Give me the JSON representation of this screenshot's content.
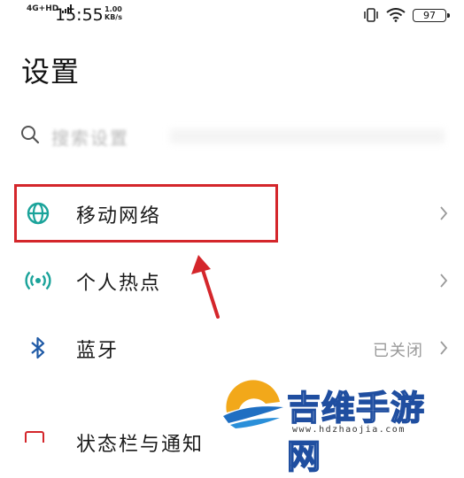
{
  "status_bar": {
    "network": "4G+HD",
    "time": "15:55",
    "speed_value": "1.00",
    "speed_unit": "KB/s",
    "battery": "97"
  },
  "page": {
    "title": "设置"
  },
  "search": {
    "placeholder": "搜索设置"
  },
  "settings_items": [
    {
      "label": "移动网络",
      "value": "",
      "icon": "globe-icon",
      "highlighted": true
    },
    {
      "label": "个人热点",
      "value": "",
      "icon": "hotspot-icon"
    },
    {
      "label": "蓝牙",
      "value": "已关闭",
      "icon": "bluetooth-icon"
    },
    {
      "label": "状态栏与通知",
      "value": "",
      "icon": "status-bar-icon"
    }
  ],
  "colors": {
    "accent_teal": "#1aa39a",
    "bluetooth_blue": "#1f5aa6",
    "annotation_red": "#d4262b"
  },
  "watermark": {
    "text": "吉维手游网",
    "url": "www.hdzhaojia.com"
  }
}
